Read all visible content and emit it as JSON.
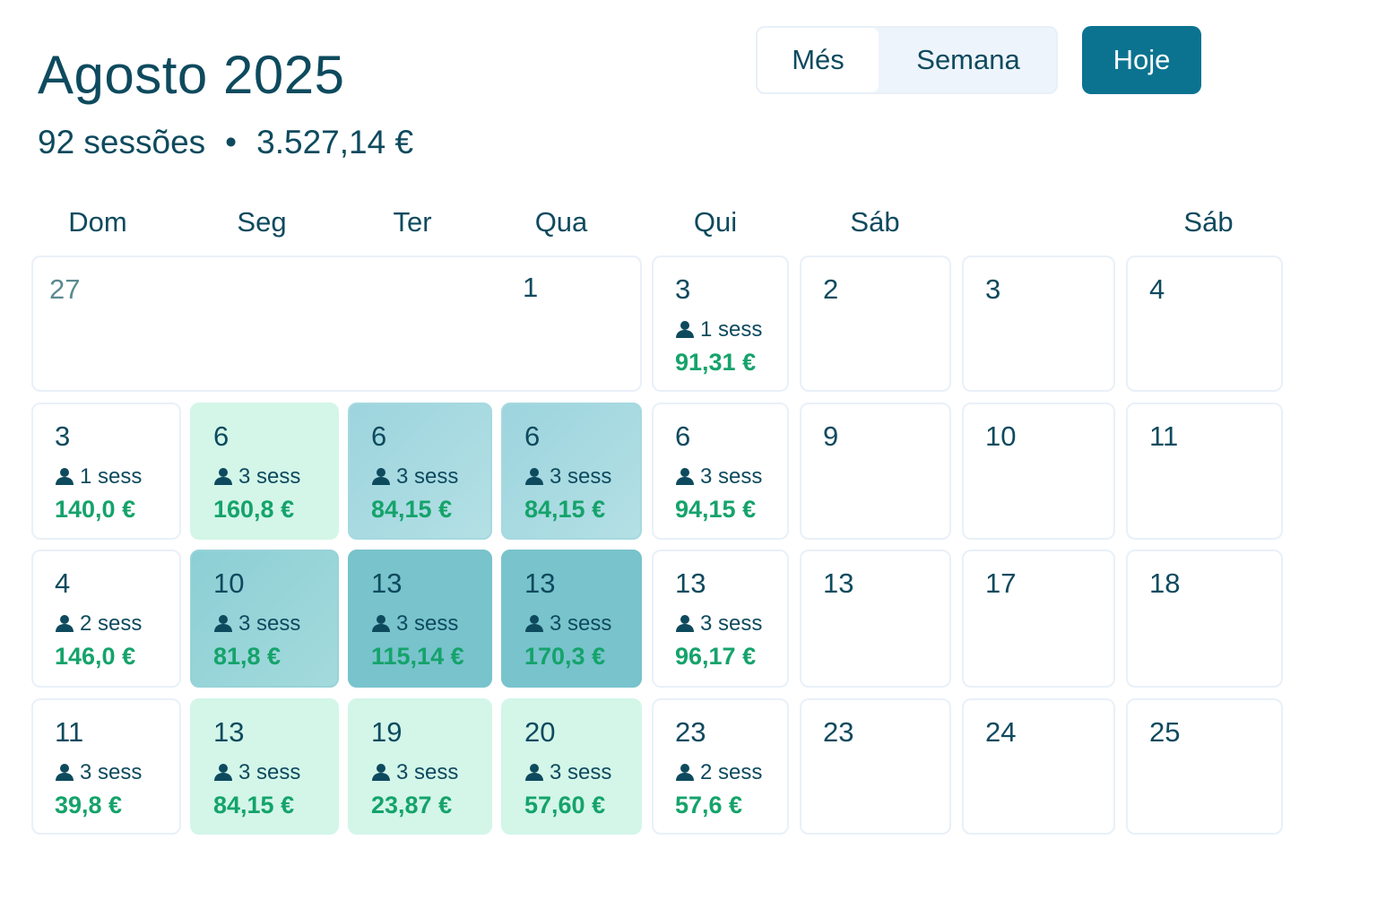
{
  "header": {
    "title": "Agosto 2025",
    "sessions": "92 sessões",
    "separator": "•",
    "total": "3.527,14 €"
  },
  "toolbar": {
    "month_label": "Més",
    "week_label": "Semana",
    "today_label": "Hoje"
  },
  "weekdays": [
    "Dom",
    "Seg",
    "Ter",
    "Qua",
    "Qui",
    "Sáb",
    "Sáb"
  ],
  "colors": {
    "accent": "#0b7390",
    "amount": "#15a36b",
    "mint": "#d3f6e9",
    "teal": "#78c3cc"
  },
  "person_icon": "person-icon",
  "cells": [
    {
      "day": "27",
      "sess": "",
      "amount": ""
    },
    {
      "day": "1",
      "sess": "",
      "amount": ""
    },
    {
      "day": "3",
      "sess": "1 sess",
      "amount": "91,31 €"
    },
    {
      "day": "2",
      "sess": "",
      "amount": ""
    },
    {
      "day": "3",
      "sess": "",
      "amount": ""
    },
    {
      "day": "4",
      "sess": "",
      "amount": ""
    },
    {
      "day": "3",
      "sess": "1 sess",
      "amount": "140,0 €"
    },
    {
      "day": "6",
      "sess": "3 sess",
      "amount": "160,8 €"
    },
    {
      "day": "6",
      "sess": "3 sess",
      "amount": "84,15 €"
    },
    {
      "day": "6",
      "sess": "3 sess",
      "amount": "84,15 €"
    },
    {
      "day": "6",
      "sess": "3 sess",
      "amount": "94,15 €"
    },
    {
      "day": "9",
      "sess": "",
      "amount": ""
    },
    {
      "day": "10",
      "sess": "",
      "amount": ""
    },
    {
      "day": "11",
      "sess": "",
      "amount": ""
    },
    {
      "day": "4",
      "sess": "2 sess",
      "amount": "146,0 €"
    },
    {
      "day": "10",
      "sess": "3 sess",
      "amount": "81,8 €"
    },
    {
      "day": "13",
      "sess": "3 sess",
      "amount": "115,14 €"
    },
    {
      "day": "13",
      "sess": "3 sess",
      "amount": "170,3 €"
    },
    {
      "day": "13",
      "sess": "3 sess",
      "amount": "96,17 €"
    },
    {
      "day": "13",
      "sess": "",
      "amount": ""
    },
    {
      "day": "17",
      "sess": "",
      "amount": ""
    },
    {
      "day": "18",
      "sess": "",
      "amount": ""
    },
    {
      "day": "11",
      "sess": "3 sess",
      "amount": "39,8 €"
    },
    {
      "day": "13",
      "sess": "3 sess",
      "amount": "84,15 €"
    },
    {
      "day": "19",
      "sess": "3 sess",
      "amount": "23,87 €"
    },
    {
      "day": "20",
      "sess": "3 sess",
      "amount": "57,60 €"
    },
    {
      "day": "23",
      "sess": "2 sess",
      "amount": "57,6 €"
    },
    {
      "day": "23",
      "sess": "",
      "amount": ""
    },
    {
      "day": "24",
      "sess": "",
      "amount": ""
    },
    {
      "day": "25",
      "sess": "",
      "amount": ""
    }
  ]
}
